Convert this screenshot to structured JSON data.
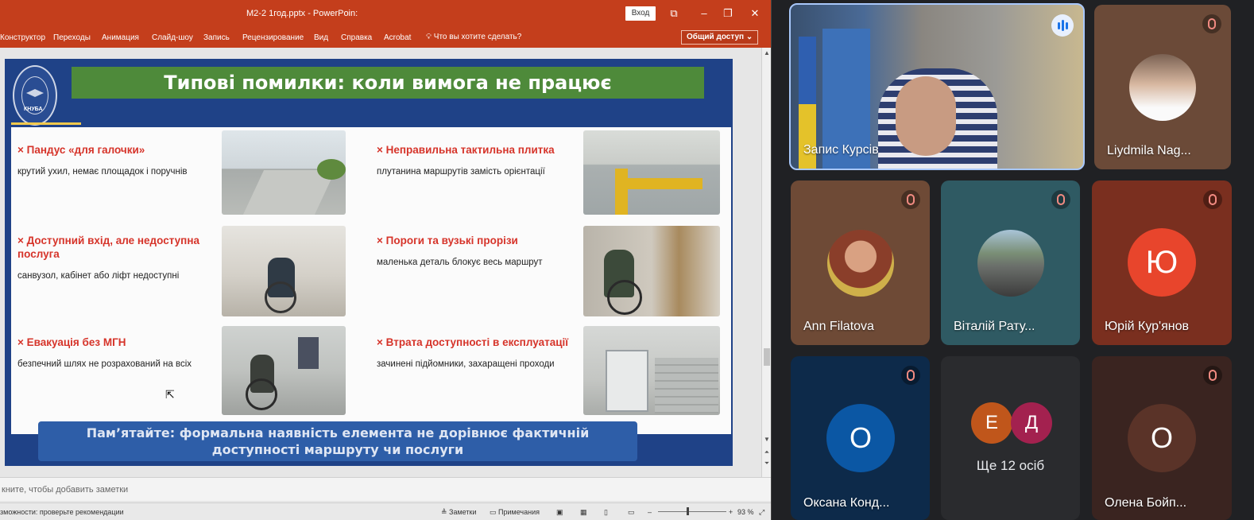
{
  "ppt": {
    "doc_title": "М2-2 1год.pptx - PowerPoin:",
    "signin": "Вход",
    "tabs": [
      "Конструктор",
      "Переходы",
      "Анимация",
      "Слайд-шоу",
      "Запись",
      "Рецензирование",
      "Вид",
      "Справка",
      "Acrobat"
    ],
    "tell_me": "Что вы хотите сделать?",
    "share": "Общий доступ",
    "notes_placeholder": "кните, чтобы добавить заметки",
    "status_left": "зможности: проверьте рекомендации",
    "status_notes": "Заметки",
    "status_comments": "Примечания",
    "zoom": "93 %"
  },
  "slide": {
    "title": "Типові помилки: коли вимога не працює",
    "logo_text": "КНУБА",
    "items": [
      {
        "heading": "× Пандус «для галочки»",
        "desc": "крутий ухил, немає площадок і поручнів"
      },
      {
        "heading": "× Неправильна тактильна плитка",
        "desc": "плутанина маршрутів замість орієнтації"
      },
      {
        "heading": "× Доступний вхід, але недоступна послуга",
        "desc": "санвузол, кабінет або ліфт недоступні"
      },
      {
        "heading": "× Пороги та вузькі прорізи",
        "desc": "маленька деталь блокує весь маршрут"
      },
      {
        "heading": "× Евакуація без МГН",
        "desc": "безпечний шлях не розрахований на всіх"
      },
      {
        "heading": "× Втрата доступності в експлуатації",
        "desc": "зачинені підйомники, захаращені проходи"
      }
    ],
    "remember_line1": "Пам’ятайте: формальна наявність елемента не дорівнює фактичній",
    "remember_line2": "доступності маршруту чи послуги"
  },
  "participants": [
    {
      "name": "Запис Курсів",
      "muted": false,
      "speaking": true
    },
    {
      "name": "Liydmila Nag...",
      "muted": true
    },
    {
      "name": "Ann Filatova",
      "muted": true
    },
    {
      "name": "Віталій Рату...",
      "muted": true
    },
    {
      "name": "Юрій Кур'янов",
      "muted": true,
      "initial": "Ю",
      "color": "#e8452c"
    },
    {
      "name": "Оксана Конд...",
      "muted": true,
      "initial": "О",
      "color": "#0b57a4"
    },
    {
      "more_label": "Ще 12 осіб",
      "initials": [
        "Е",
        "Д"
      ],
      "colors": [
        "#c0561b",
        "#a3214f"
      ]
    },
    {
      "name": "Олена Бойп...",
      "muted": true,
      "initial": "О",
      "color": "#6a3a2c"
    }
  ]
}
